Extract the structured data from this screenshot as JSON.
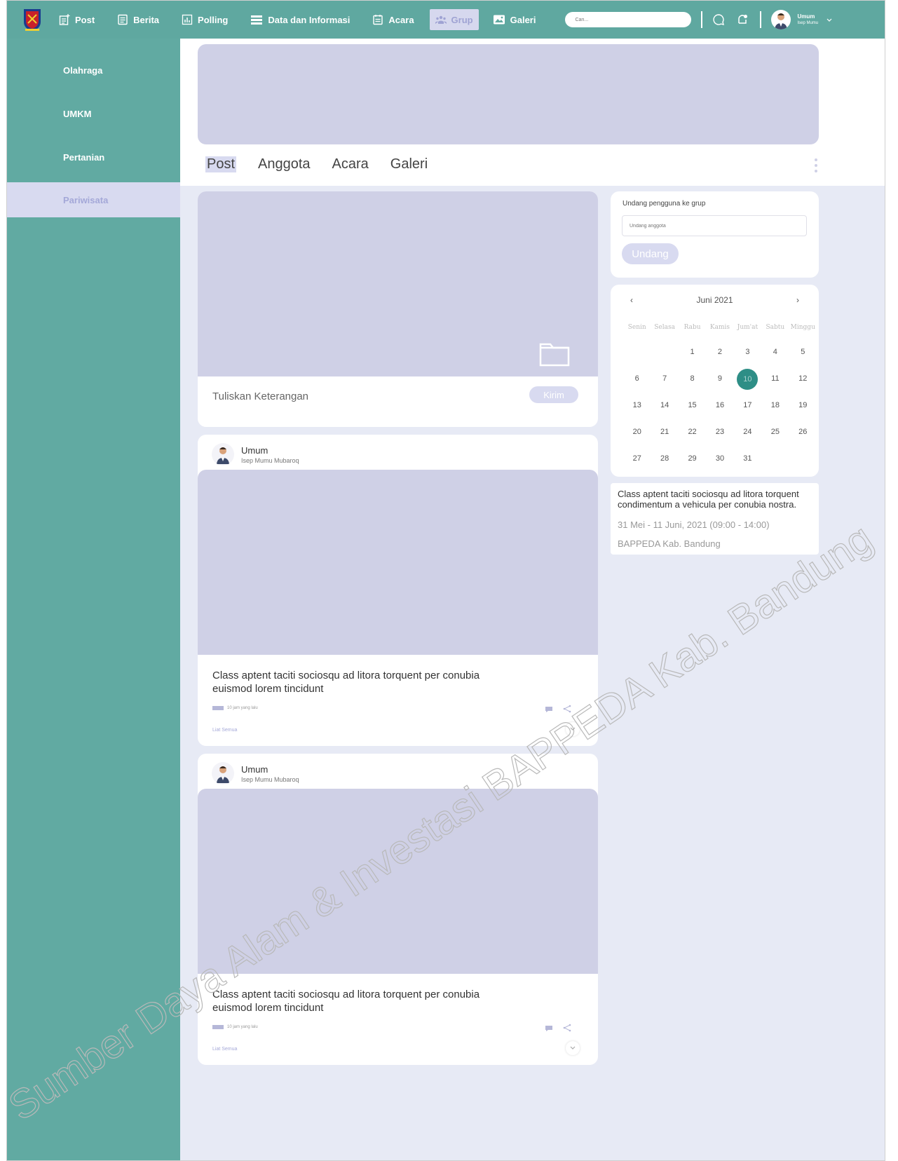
{
  "nav": {
    "items": [
      {
        "label": "Post",
        "icon": "post-add-icon"
      },
      {
        "label": "Berita",
        "icon": "news-icon"
      },
      {
        "label": "Polling",
        "icon": "poll-icon"
      },
      {
        "label": "Data dan Informasi",
        "icon": "list-icon"
      },
      {
        "label": "Acara",
        "icon": "event-icon"
      },
      {
        "label": "Grup",
        "icon": "group-icon"
      },
      {
        "label": "Galeri",
        "icon": "gallery-icon"
      }
    ],
    "search_placeholder": "Cari...",
    "user_name": "Umum",
    "user_sub": "Isep Mumu"
  },
  "sidebar": {
    "items": [
      "Olahraga",
      "UMKM",
      "Pertanian",
      "Pariwisata"
    ]
  },
  "tabs": [
    "Post",
    "Anggota",
    "Acara",
    "Galeri"
  ],
  "composer": {
    "caption_placeholder": "Tuliskan Keterangan",
    "send_label": "Kirim"
  },
  "posts": [
    {
      "author": "Umum",
      "sub": "Isep Mumu Mubaroq",
      "text": "Class aptent taciti sociosqu ad litora torquent per conubia euismod lorem tincidunt",
      "time": "10 jam yang lalu",
      "link": "Liat Semua"
    },
    {
      "author": "Umum",
      "sub": "Isep Mumu Mubaroq",
      "text": "Class aptent taciti sociosqu ad litora torquent per conubia euismod lorem tincidunt",
      "time": "10 jam yang lalu",
      "link": "Liat Semua"
    }
  ],
  "invite": {
    "title": "Undang pengguna ke grup",
    "placeholder": "Undang anggota",
    "button": "Undang"
  },
  "calendar": {
    "month": "Juni 2021",
    "prev": "‹",
    "next": "›",
    "days_of_week": [
      "Senin",
      "Selasa",
      "Rabu",
      "Kamis",
      "Jum'at",
      "Sabtu",
      "Minggu"
    ],
    "weeks": [
      [
        "",
        "",
        "1",
        "2",
        "3",
        "4",
        "5"
      ],
      [
        "6",
        "7",
        "8",
        "9",
        "10",
        "11",
        "12"
      ],
      [
        "13",
        "14",
        "15",
        "16",
        "17",
        "18",
        "19"
      ],
      [
        "20",
        "21",
        "22",
        "23",
        "24",
        "25",
        "26"
      ],
      [
        "27",
        "28",
        "29",
        "30",
        "31",
        "",
        ""
      ]
    ],
    "selected": "10"
  },
  "event": {
    "description": "Class aptent taciti sociosqu ad litora torquent condimentum a vehicula per conubia nostra.",
    "date": "31 Mei - 11 Juni, 2021 (09:00 - 14:00)",
    "location": "BAPPEDA Kab. Bandung"
  },
  "watermark": "Sumber Daya Alam & Investasi BAPPEDA Kab. Bandung",
  "colors": {
    "primary": "#5fa8a0",
    "accent_lavender": "#cfd0e6",
    "selected_day": "#2e8e86"
  }
}
